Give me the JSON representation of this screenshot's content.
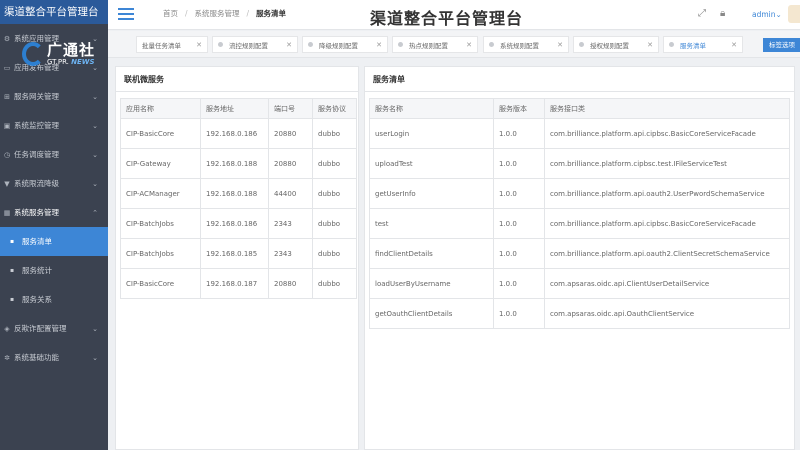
{
  "brand": "渠道整合平台管理台",
  "watermark": {
    "cn": "广通社",
    "en_prefix": "GT.PR.",
    "en_news": "NEWS"
  },
  "sidebar": {
    "items": [
      {
        "label": "系统应用管理",
        "chevron": "chevron-down"
      },
      {
        "label": "应用发布管理",
        "chevron": "chevron-down"
      },
      {
        "label": "服务网关管理",
        "chevron": "chevron-down"
      },
      {
        "label": "系统监控管理",
        "chevron": "chevron-down"
      },
      {
        "label": "任务调度管理",
        "chevron": "chevron-down"
      },
      {
        "label": "系统限流降级",
        "chevron": "chevron-down"
      },
      {
        "label": "系统服务管理",
        "chevron": "chevron-up",
        "open": true
      }
    ],
    "sub_items": [
      {
        "label": "服务清单",
        "active": true
      },
      {
        "label": "服务统计"
      },
      {
        "label": "服务关系"
      }
    ],
    "bottom_items": [
      {
        "label": "反欺诈配置管理",
        "chevron": "chevron-down"
      },
      {
        "label": "系统基础功能",
        "chevron": "chevron-down"
      }
    ]
  },
  "header": {
    "breadcrumb": [
      "首页",
      "系统服务管理",
      "服务清单"
    ],
    "title": "渠道整合平台管理台",
    "user": "admin",
    "user_chevron": "⌄"
  },
  "tabs": [
    {
      "label": "批量任务清单"
    },
    {
      "label": "流控规则配置"
    },
    {
      "label": "降级规则配置"
    },
    {
      "label": "热点规则配置"
    },
    {
      "label": "系统规则配置"
    },
    {
      "label": "授权规则配置"
    },
    {
      "label": "服务清单",
      "active": true
    }
  ],
  "tab_options_label": "标签选项",
  "panels": {
    "left": {
      "title": "联机微服务",
      "columns": [
        "应用名称",
        "服务地址",
        "端口号",
        "服务协议"
      ],
      "rows": [
        [
          "CIP-BasicCore",
          "192.168.0.186",
          "20880",
          "dubbo"
        ],
        [
          "CIP-Gateway",
          "192.168.0.188",
          "20880",
          "dubbo"
        ],
        [
          "CIP-ACManager",
          "192.168.0.188",
          "44400",
          "dubbo"
        ],
        [
          "CIP-BatchJobs",
          "192.168.0.186",
          "2343",
          "dubbo"
        ],
        [
          "CIP-BatchJobs",
          "192.168.0.185",
          "2343",
          "dubbo"
        ],
        [
          "CIP-BasicCore",
          "192.168.0.187",
          "20880",
          "dubbo"
        ]
      ]
    },
    "right": {
      "title": "服务清单",
      "columns": [
        "服务名称",
        "服务版本",
        "服务接口类"
      ],
      "rows": [
        [
          "userLogin",
          "1.0.0",
          "com.brilliance.platform.api.cipbsc.BasicCoreServiceFacade"
        ],
        [
          "uploadTest",
          "1.0.0",
          "com.brilliance.platform.cipbsc.test.IFileServiceTest"
        ],
        [
          "getUserInfo",
          "1.0.0",
          "com.brilliance.platform.api.oauth2.UserPwordSchemaService"
        ],
        [
          "test",
          "1.0.0",
          "com.brilliance.platform.api.cipbsc.BasicCoreServiceFacade"
        ],
        [
          "findClientDetails",
          "1.0.0",
          "com.brilliance.platform.api.oauth2.ClientSecretSchemaService"
        ],
        [
          "loadUserByUsername",
          "1.0.0",
          "com.apsaras.oidc.api.ClientUserDetailService"
        ],
        [
          "getOauthClientDetails",
          "1.0.0",
          "com.apsaras.oidc.api.OauthClientService"
        ]
      ]
    }
  },
  "colors": {
    "accent": "#3d86d6",
    "sidebar_bg": "#3b4250",
    "brand_bg": "#2b5a9a"
  }
}
